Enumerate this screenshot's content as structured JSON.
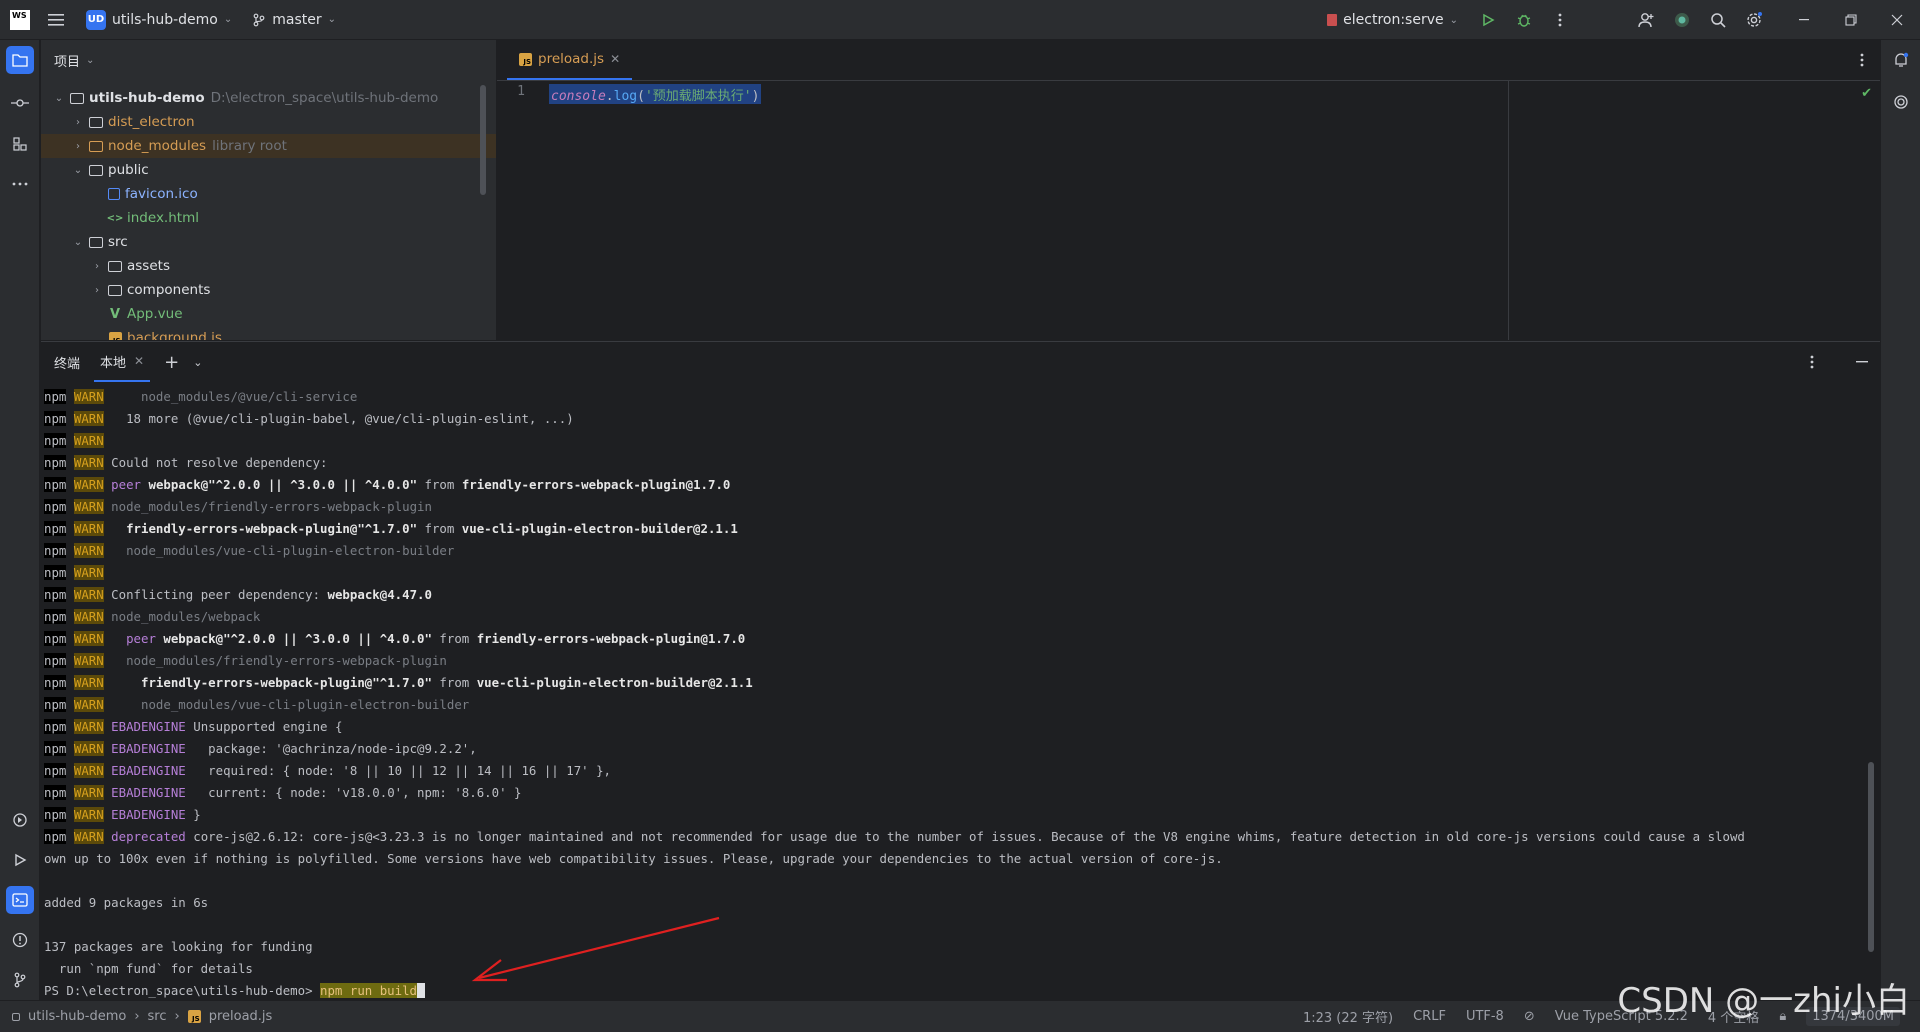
{
  "titlebar": {
    "logo_text": "WS",
    "project_badge": "UD",
    "project_name": "utils-hub-demo",
    "branch": "master",
    "run_config": "electron:serve"
  },
  "project_panel": {
    "header": "项目",
    "tree": [
      {
        "label": "utils-hub-demo",
        "extra": "D:\\electron_space\\utils-hub-demo",
        "kind": "folder",
        "expanded": true
      },
      {
        "label": "dist_electron",
        "kind": "folder",
        "color": "#d69d54"
      },
      {
        "label": "node_modules",
        "extra": "library root",
        "kind": "folder",
        "color": "#d69d54"
      },
      {
        "label": "public",
        "kind": "folder",
        "expanded": true
      },
      {
        "label": "favicon.ico",
        "kind": "file"
      },
      {
        "label": "index.html",
        "kind": "file"
      },
      {
        "label": "src",
        "kind": "folder",
        "expanded": true
      },
      {
        "label": "assets",
        "kind": "folder"
      },
      {
        "label": "components",
        "kind": "folder"
      },
      {
        "label": "App.vue",
        "kind": "file"
      },
      {
        "label": "background.js",
        "kind": "file"
      }
    ]
  },
  "editor": {
    "tab_label": "preload.js",
    "line_number": "1",
    "code": {
      "console": "console",
      "dot": ".",
      "method": "log",
      "open": "(",
      "string": "'预加载脚本执行'",
      "close": ")"
    }
  },
  "terminal": {
    "title": "终端",
    "tab_label": "本地",
    "lines": [
      {
        "warn": true,
        "segs": [
          {
            "t": "    node_modules/@vue/cli-service",
            "c": "dim"
          }
        ]
      },
      {
        "warn": true,
        "segs": [
          {
            "t": "  18 more (@vue/cli-plugin-babel, @vue/cli-plugin-eslint, ...)",
            "c": ""
          }
        ]
      },
      {
        "warn": true,
        "segs": []
      },
      {
        "warn": true,
        "segs": [
          {
            "t": "Could not resolve dependency:",
            "c": ""
          }
        ]
      },
      {
        "warn": true,
        "segs": [
          {
            "t": "peer ",
            "c": "kw"
          },
          {
            "t": "webpack@\"^2.0.0 || ^3.0.0 || ^4.0.0\"",
            "c": "bold"
          },
          {
            "t": " from ",
            "c": ""
          },
          {
            "t": "friendly-errors-webpack-plugin@1.7.0",
            "c": "bold"
          }
        ]
      },
      {
        "warn": true,
        "segs": [
          {
            "t": "node_modules/friendly-errors-webpack-plugin",
            "c": "dim"
          }
        ]
      },
      {
        "warn": true,
        "segs": [
          {
            "t": "  ",
            "c": ""
          },
          {
            "t": "friendly-errors-webpack-plugin@\"^1.7.0\"",
            "c": "bold"
          },
          {
            "t": " from ",
            "c": ""
          },
          {
            "t": "vue-cli-plugin-electron-builder@2.1.1",
            "c": "bold"
          }
        ]
      },
      {
        "warn": true,
        "segs": [
          {
            "t": "  node_modules/vue-cli-plugin-electron-builder",
            "c": "dim"
          }
        ]
      },
      {
        "warn": true,
        "segs": []
      },
      {
        "warn": true,
        "segs": [
          {
            "t": "Conflicting peer dependency: ",
            "c": ""
          },
          {
            "t": "webpack@4.47.0",
            "c": "bold"
          }
        ]
      },
      {
        "warn": true,
        "segs": [
          {
            "t": "node_modules/webpack",
            "c": "dim"
          }
        ]
      },
      {
        "warn": true,
        "segs": [
          {
            "t": "  peer ",
            "c": "kw"
          },
          {
            "t": "webpack@\"^2.0.0 || ^3.0.0 || ^4.0.0\"",
            "c": "bold"
          },
          {
            "t": " from ",
            "c": ""
          },
          {
            "t": "friendly-errors-webpack-plugin@1.7.0",
            "c": "bold"
          }
        ]
      },
      {
        "warn": true,
        "segs": [
          {
            "t": "  node_modules/friendly-errors-webpack-plugin",
            "c": "dim"
          }
        ]
      },
      {
        "warn": true,
        "segs": [
          {
            "t": "    ",
            "c": ""
          },
          {
            "t": "friendly-errors-webpack-plugin@\"^1.7.0\"",
            "c": "bold"
          },
          {
            "t": " from ",
            "c": ""
          },
          {
            "t": "vue-cli-plugin-electron-builder@2.1.1",
            "c": "bold"
          }
        ]
      },
      {
        "warn": true,
        "segs": [
          {
            "t": "    node_modules/vue-cli-plugin-electron-builder",
            "c": "dim"
          }
        ]
      },
      {
        "warn": true,
        "segs": [
          {
            "t": "EBADENGINE",
            "c": "kw"
          },
          {
            "t": " Unsupported engine {",
            "c": ""
          }
        ]
      },
      {
        "warn": true,
        "segs": [
          {
            "t": "EBADENGINE",
            "c": "kw"
          },
          {
            "t": "   package: '@achrinza/node-ipc@9.2.2',",
            "c": ""
          }
        ]
      },
      {
        "warn": true,
        "segs": [
          {
            "t": "EBADENGINE",
            "c": "kw"
          },
          {
            "t": "   required: { node: '8 || 10 || 12 || 14 || 16 || 17' },",
            "c": ""
          }
        ]
      },
      {
        "warn": true,
        "segs": [
          {
            "t": "EBADENGINE",
            "c": "kw"
          },
          {
            "t": "   current: { node: 'v18.0.0', npm: '8.6.0' }",
            "c": ""
          }
        ]
      },
      {
        "warn": true,
        "segs": [
          {
            "t": "EBADENGINE",
            "c": "kw"
          },
          {
            "t": " }",
            "c": ""
          }
        ]
      },
      {
        "warn": true,
        "segs": [
          {
            "t": "deprecated",
            "c": "kw"
          },
          {
            "t": " core-js@2.6.12: core-js@<3.23.3 is no longer maintained and not recommended for usage due to the number of issues. Because of the V8 engine whims, feature detection in old core-js versions could cause a slowd",
            "c": ""
          }
        ]
      },
      {
        "warn": false,
        "segs": [
          {
            "t": "own up to 100x even if nothing is polyfilled. Some versions have web compatibility issues. Please, upgrade your dependencies to the actual version of core-js.",
            "c": ""
          }
        ]
      },
      {
        "warn": false,
        "segs": []
      },
      {
        "warn": false,
        "segs": [
          {
            "t": "added 9 packages in 6s",
            "c": ""
          }
        ]
      },
      {
        "warn": false,
        "segs": []
      },
      {
        "warn": false,
        "segs": [
          {
            "t": "137 packages are looking for funding",
            "c": ""
          }
        ]
      },
      {
        "warn": false,
        "segs": [
          {
            "t": "  run `npm fund` for details",
            "c": ""
          }
        ]
      }
    ],
    "npm_label": "npm",
    "warn_label": "WARN",
    "prompt": "PS D:\\electron_space\\utils-hub-demo> ",
    "command": "npm run build"
  },
  "statusbar": {
    "crumbs": [
      "utils-hub-demo",
      "src",
      "preload.js"
    ],
    "position": "1:23 (22 字符)",
    "line_sep": "CRLF",
    "encoding": "UTF-8",
    "language": "Vue TypeScript 5.2.2",
    "indent": "4 个空格",
    "memory": "1374/3400M"
  },
  "watermark": "CSDN @一zhi小白"
}
